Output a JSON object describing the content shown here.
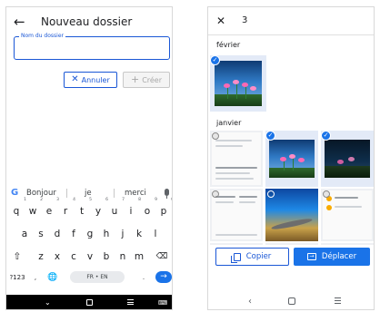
{
  "left_screen": {
    "back_icon": "arrow-left",
    "title": "Nouveau dossier",
    "field_label": "Nom du dossier",
    "field_value": "",
    "cancel_label": "Annuler",
    "create_label": "Créer",
    "keyboard": {
      "suggestions": [
        "Bonjour",
        "je",
        "merci"
      ],
      "row1": [
        "q",
        "w",
        "e",
        "r",
        "t",
        "y",
        "u",
        "i",
        "o",
        "p"
      ],
      "row1_hints": [
        "1",
        "2",
        "3",
        "4",
        "5",
        "6",
        "7",
        "8",
        "9",
        "0"
      ],
      "row2": [
        "a",
        "s",
        "d",
        "f",
        "g",
        "h",
        "j",
        "k",
        "l"
      ],
      "row3": [
        "z",
        "x",
        "c",
        "v",
        "b",
        "n",
        "m"
      ],
      "symbols_key": "?123",
      "comma_key": ",",
      "period_key": ".",
      "space_label": "FR • EN"
    }
  },
  "right_screen": {
    "close_icon": "close-x",
    "selected_count": "3",
    "sections": [
      "février",
      "janvier"
    ],
    "copy_label": "Copier",
    "move_label": "Déplacer"
  },
  "colors": {
    "accent": "#1a73e8",
    "outline_blue": "#1a57d6",
    "disabled": "#a8a8a8",
    "nav_dark": "#000000"
  }
}
